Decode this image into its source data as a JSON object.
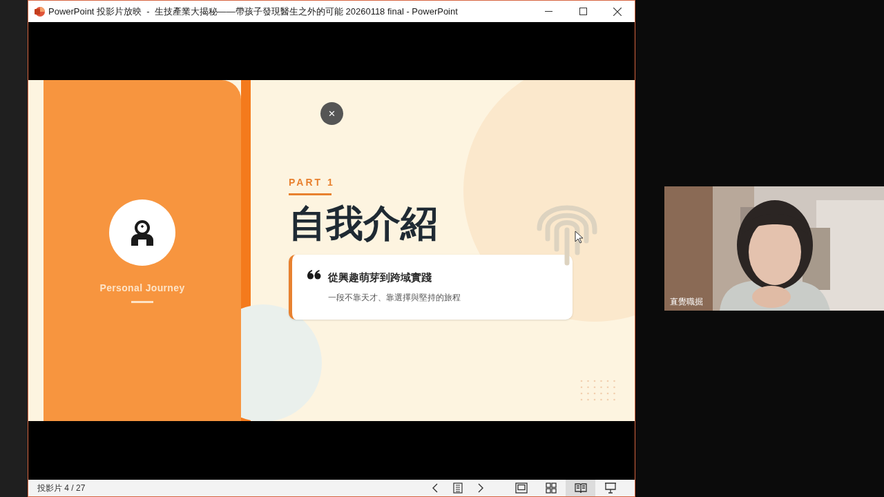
{
  "window": {
    "title": "PowerPoint 投影片放映  -  生技產業大揭秘——帶孩子發現醫生之外的可能 20260118 final - PowerPoint"
  },
  "slide": {
    "subtitle": "Personal Journey",
    "close": "×",
    "part": "PART 1",
    "title": "自我介紹",
    "quote_heading": "從興趣萌芽到跨域實踐",
    "quote_text": "一段不靠天才、靠選擇與堅持的旅程"
  },
  "status_bar": {
    "slide_counter": "投影片 4 / 27",
    "views": [
      {
        "kind": "normal",
        "selected": false
      },
      {
        "kind": "sorter",
        "selected": false
      },
      {
        "kind": "reading",
        "selected": true
      },
      {
        "kind": "slideshow",
        "selected": false
      }
    ]
  },
  "video": {
    "name": "直覺職掘"
  }
}
